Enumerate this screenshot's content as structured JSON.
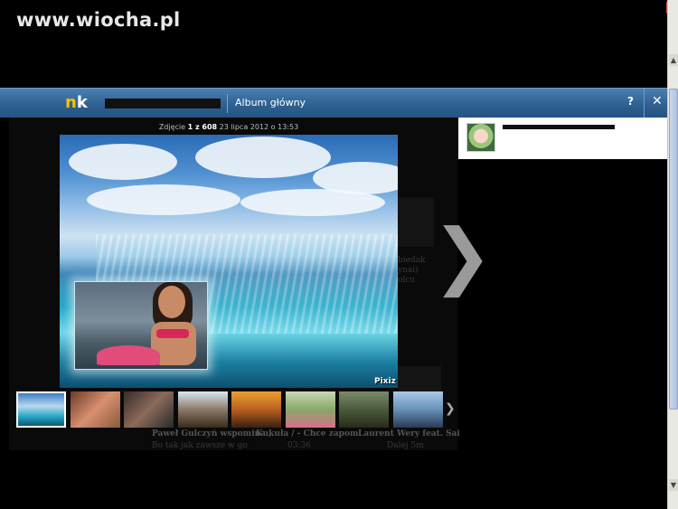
{
  "watermark": "www.wiocha.pl",
  "topbar": {
    "logo_n": "n",
    "logo_k": "k",
    "album_link": "Album główny",
    "help_label": "?",
    "close_label": "✕"
  },
  "photo_info": {
    "prefix": "Zdjęcie",
    "position": "1 z 608",
    "date": "23 lipca 2012 o 13:53"
  },
  "photo": {
    "watermark": "Pixiz"
  },
  "navigation": {
    "next_arrow": "❯",
    "thumbs_more": "❯"
  },
  "background_texts": {
    "t1": "Paweł Gulczyń wspomina ,",
    "t2": "Bo tak jak zawsze w go",
    "t3": "Kukuła / - Chce zapom",
    "t4": "03:36",
    "t5": "Laurent Wery feat. Sai",
    "t6": "Dalej 5m",
    "t7": "biedak",
    "t8": "ynai)",
    "t9": "olcu"
  },
  "browser": {
    "scroll_up": "▲",
    "scroll_down": "▼",
    "window_close": "x"
  },
  "colors": {
    "topbar": "#2d5f8f",
    "logo_n": "#f3c400",
    "selected_thumb_border": "#ffffff"
  },
  "thumbnails": [
    {
      "label": "thumb-1",
      "selected": true
    },
    {
      "label": "thumb-2",
      "selected": false
    },
    {
      "label": "thumb-3",
      "selected": false
    },
    {
      "label": "thumb-4",
      "selected": false
    },
    {
      "label": "thumb-5",
      "selected": false
    },
    {
      "label": "thumb-6",
      "selected": false
    },
    {
      "label": "thumb-7",
      "selected": false
    },
    {
      "label": "thumb-8",
      "selected": false
    }
  ]
}
